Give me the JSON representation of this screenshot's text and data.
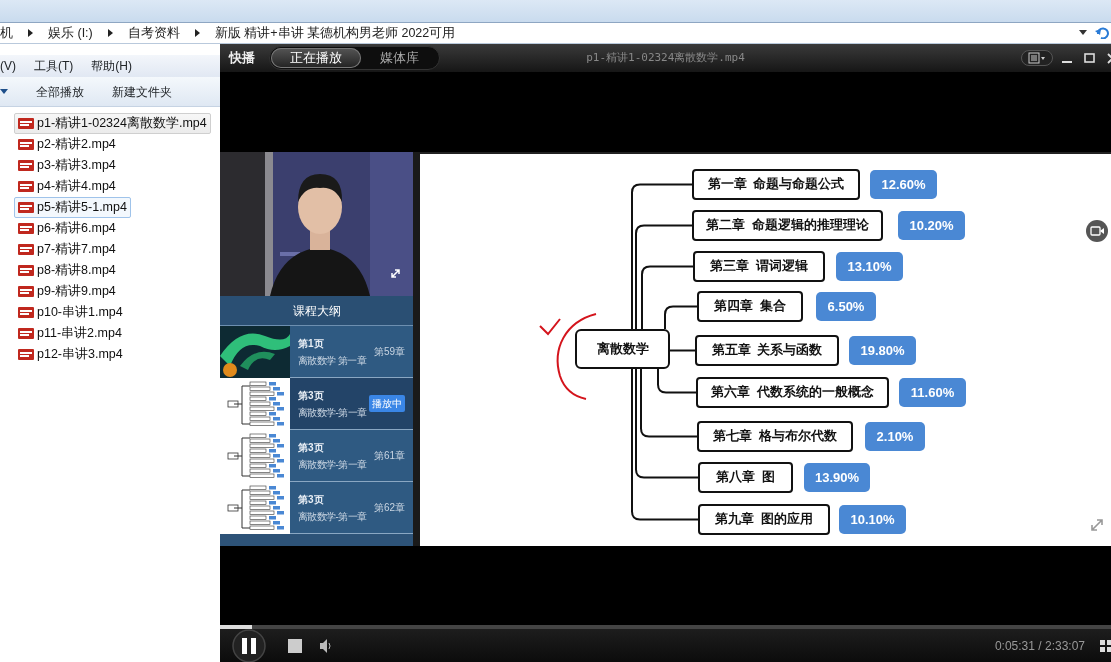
{
  "explorer": {
    "breadcrumb": [
      "机",
      "娱乐 (I:)",
      "自考资料",
      "新版 精讲+串讲 某德机构男老师 2022可用"
    ],
    "menu": [
      "(V)",
      "工具(T)",
      "帮助(H)"
    ],
    "toolbar": [
      "全部播放",
      "新建文件夹"
    ],
    "files": [
      {
        "name": "p1-精讲1-02324离散数学.mp4",
        "selected": true,
        "focused": false
      },
      {
        "name": "p2-精讲2.mp4",
        "selected": false,
        "focused": false
      },
      {
        "name": "p3-精讲3.mp4",
        "selected": false,
        "focused": false
      },
      {
        "name": "p4-精讲4.mp4",
        "selected": false,
        "focused": false
      },
      {
        "name": "p5-精讲5-1.mp4",
        "selected": false,
        "focused": true
      },
      {
        "name": "p6-精讲6.mp4",
        "selected": false,
        "focused": false
      },
      {
        "name": "p7-精讲7.mp4",
        "selected": false,
        "focused": false
      },
      {
        "name": "p8-精讲8.mp4",
        "selected": false,
        "focused": false
      },
      {
        "name": "p9-精讲9.mp4",
        "selected": false,
        "focused": false
      },
      {
        "name": "p10-串讲1.mp4",
        "selected": false,
        "focused": false
      },
      {
        "name": "p11-串讲2.mp4",
        "selected": false,
        "focused": false
      },
      {
        "name": "p12-串讲3.mp4",
        "selected": false,
        "focused": false
      }
    ]
  },
  "player": {
    "brand": "快播",
    "tabs": [
      {
        "label": "正在播放",
        "selected": true
      },
      {
        "label": "媒体库",
        "selected": false
      }
    ],
    "title": "p1-精讲1-02324离散数学.mp4",
    "outline": {
      "title": "课程大纲",
      "items": [
        {
          "kind": "aurora",
          "page": "第1页",
          "subtitle": "离散数学 第一章",
          "chapter": "第59章",
          "selected": false
        },
        {
          "kind": "mindmap",
          "page": "第3页",
          "subtitle": "离散数学-第一章",
          "badge": "播放中",
          "selected": true
        },
        {
          "kind": "mindmap",
          "page": "第3页",
          "subtitle": "离散数学-第一章",
          "chapter": "第61章",
          "selected": false
        },
        {
          "kind": "mindmap",
          "page": "第3页",
          "subtitle": "离散数学-第一章",
          "chapter": "第62章",
          "selected": false
        }
      ]
    },
    "mind_map": {
      "root": "离散数学",
      "chapters": [
        {
          "title": "第一章  命题与命题公式",
          "share": "12.60%"
        },
        {
          "title": "第二章  命题逻辑的推理理论",
          "share": "10.20%"
        },
        {
          "title": "第三章  谓词逻辑",
          "share": "13.10%"
        },
        {
          "title": "第四章  集合",
          "share": "6.50%"
        },
        {
          "title": "第五章  关系与函数",
          "share": "19.80%"
        },
        {
          "title": "第六章  代数系统的一般概念",
          "share": "11.60%"
        },
        {
          "title": "第七章  格与布尔代数",
          "share": "2.10%"
        },
        {
          "title": "第八章  图",
          "share": "13.90%"
        },
        {
          "title": "第九章  图的应用",
          "share": "10.10%"
        }
      ]
    },
    "playing": true,
    "progress": {
      "level": 0.036
    },
    "time": "0:05:31 / 2:33:07"
  }
}
